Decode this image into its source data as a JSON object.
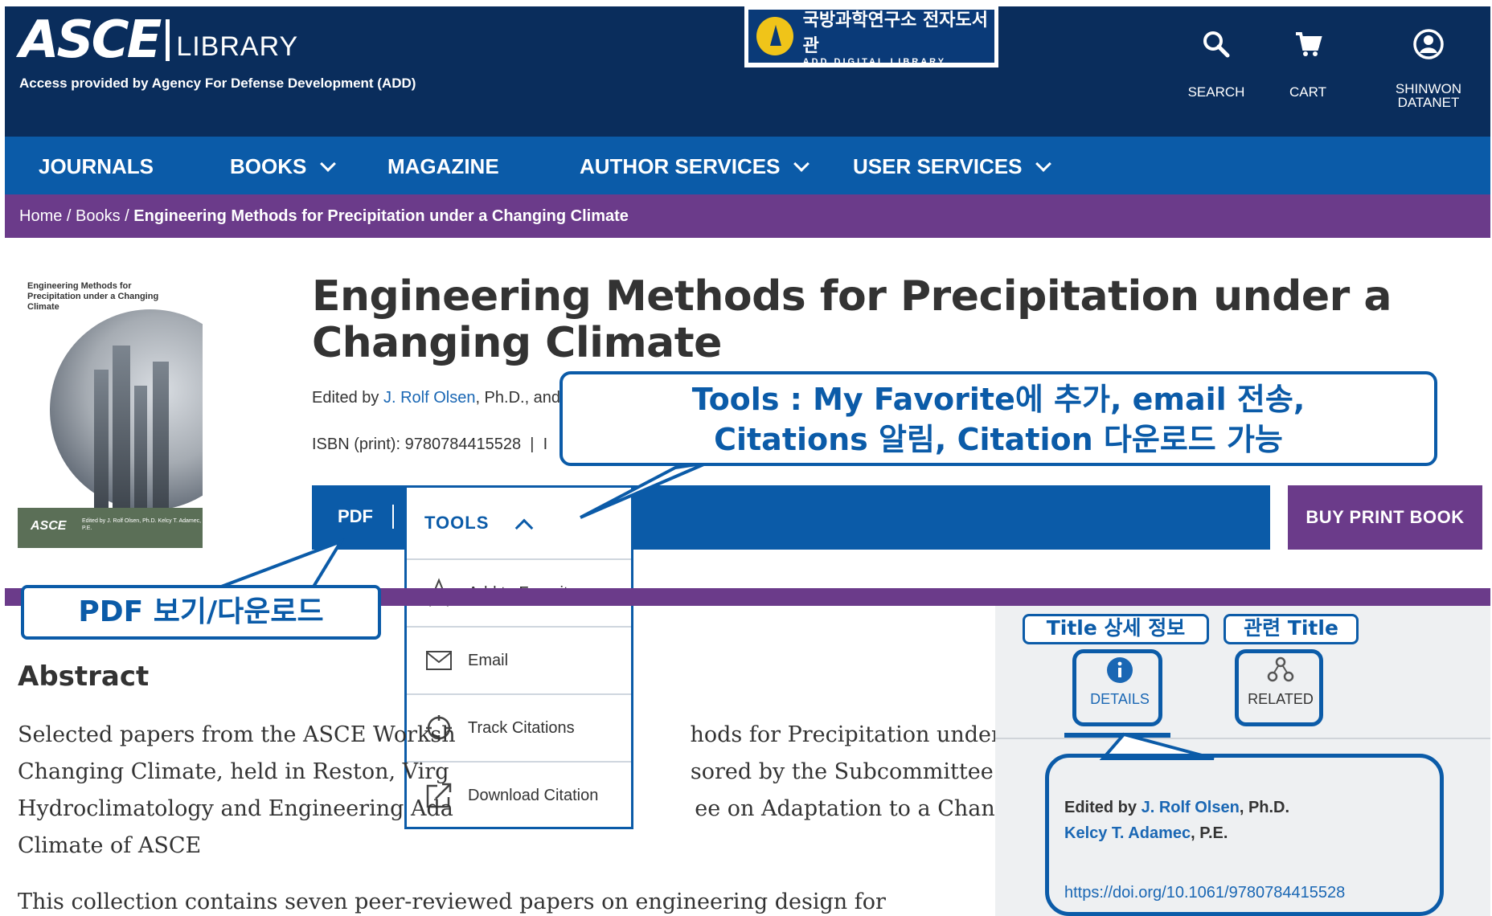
{
  "header": {
    "logo_main": "ASCE",
    "logo_sub": "LIBRARY",
    "access_text": "Access provided by Agency For Defense Development (ADD)",
    "add_banner_ko": "국방과학연구소 전자도서관",
    "add_banner_en": "ADD DIGITAL LIBRARY",
    "search_label": "SEARCH",
    "cart_label": "CART",
    "user_label_1": "SHINWON",
    "user_label_2": "DATANET",
    "colors": {
      "header_bg": "#0a2d5c",
      "nav_bg": "#0b5ba8",
      "breadcrumb_bg": "#6b3b8a"
    }
  },
  "nav": {
    "items": [
      {
        "label": "JOURNALS",
        "icon": ""
      },
      {
        "label": "BOOKS",
        "icon": "chevron-down-icon"
      },
      {
        "label": "MAGAZINE",
        "icon": ""
      },
      {
        "label": "AUTHOR SERVICES",
        "icon": "chevron-down-icon"
      },
      {
        "label": "USER SERVICES",
        "icon": "chevron-down-icon"
      }
    ]
  },
  "breadcrumb": {
    "home": "Home",
    "sep": " / ",
    "books": "Books",
    "current": "Engineering Methods for Precipitation under a Changing Climate"
  },
  "book": {
    "cover_title": "Engineering Methods for Precipitation under a Changing Climate",
    "cover_mark": "ASCE",
    "cover_editors": "Edited by J. Rolf Olsen, Ph.D. Kelcy T. Adamec, P.E.",
    "title": "Engineering Methods for Precipitation under a Changing Climate",
    "edited_prefix": "Edited by ",
    "editor_1": "J. Rolf Olsen",
    "edited_suffix": ", Ph.D., and",
    "isbn": "ISBN (print): 9780784415528  |  I"
  },
  "actions": {
    "pdf_label": "PDF",
    "tools_label": "TOOLS",
    "buy_label": "BUY PRINT BOOK",
    "tools_menu": [
      {
        "label": "Add to Favorites",
        "icon": "star-icon"
      },
      {
        "label": "Email",
        "icon": "envelope-icon"
      },
      {
        "label": "Track Citations",
        "icon": "track-citations-icon"
      },
      {
        "label": "Download Citation",
        "icon": "external-link-icon"
      }
    ]
  },
  "abstract": {
    "heading": "Abstract",
    "lines": [
      "Selected papers from the ASCE Worksh                                  hods for Precipitation under a",
      "Changing Climate, held in Reston, Virg                                   sored by the Subcommittee on",
      "Hydroclimatology and Engineering Ada                                   ee on Adaptation to a Changing",
      "Climate of ASCE",
      "This collection contains seven peer-reviewed papers on engineering design for precipitation"
    ]
  },
  "side_panel": {
    "details_tab": "DETAILS",
    "related_tab": "RELATED",
    "edited_by": "Edited by",
    "editor_1": "J. Rolf Olsen",
    "editor_1_suffix": ", Ph.D.",
    "editor_2": "Kelcy T. Adamec",
    "editor_2_suffix": ", P.E.",
    "doi": "https://doi.org/10.1061/9780784415528"
  },
  "callouts": {
    "tools_line1": "Tools : My Favorite에 추가, email 전송,",
    "tools_line2": "Citations 알림, Citation 다운로드 가능",
    "pdf": "PDF 보기/다운로드",
    "details": "Title 상세 정보",
    "related": "관련 Title"
  }
}
